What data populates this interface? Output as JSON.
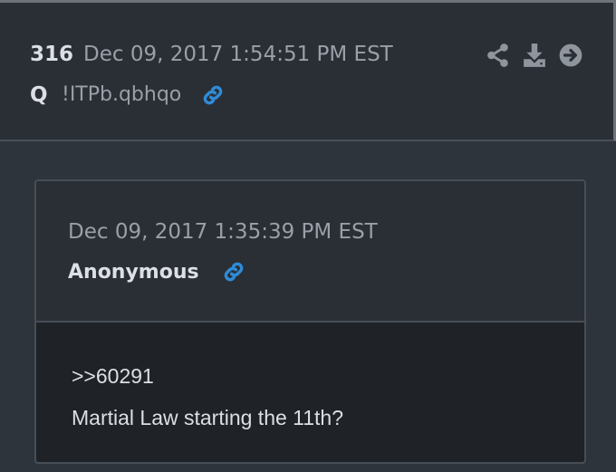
{
  "post": {
    "number": "316",
    "date": "Dec 09, 2017 1:54:51 PM EST",
    "author": "Q",
    "tripcode": "!ITPb.qbhqo",
    "actions": [
      "share-icon",
      "download-icon",
      "arrow-right-circle-icon"
    ],
    "link_icon": "link-icon"
  },
  "quote": {
    "date": "Dec 09, 2017 1:35:39 PM EST",
    "author": "Anonymous",
    "link_icon": "link-icon",
    "body": [
      ">>60291",
      "Martial Law starting the 11th?"
    ]
  },
  "colors": {
    "link": "#2f8bd6",
    "icon": "#8f959d",
    "text": "#dcdfe4",
    "muted": "#9aa0a8"
  }
}
